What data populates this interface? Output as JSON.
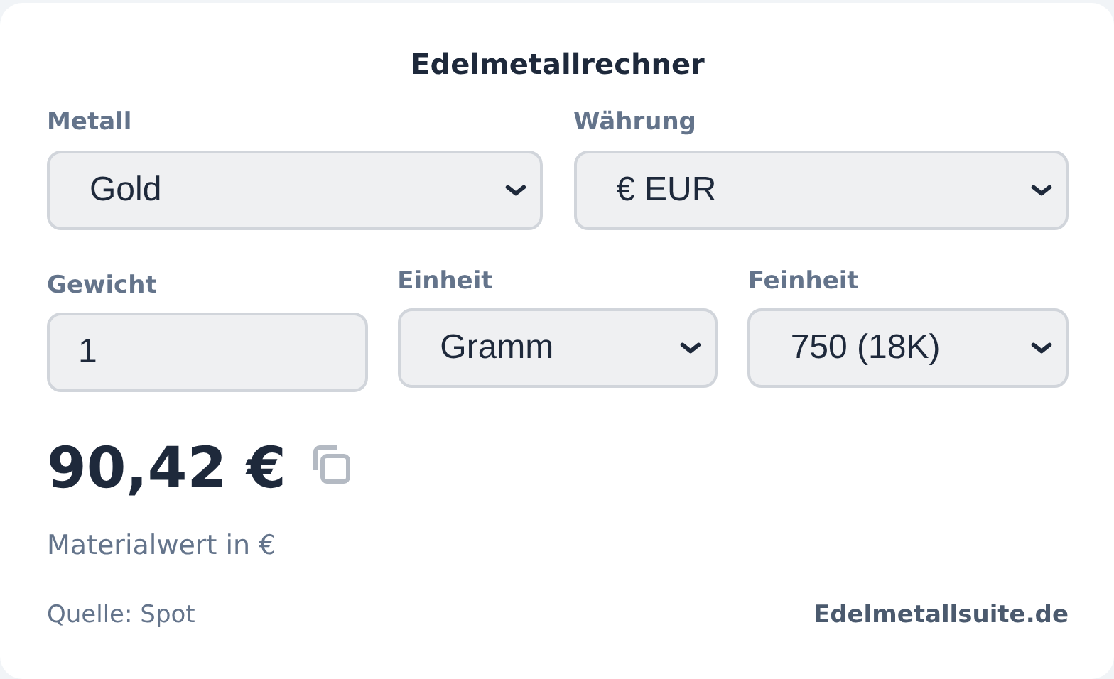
{
  "title": "Edelmetallrechner",
  "fields": [
    {
      "kind": "select",
      "label": "Metall",
      "value": "Gold"
    },
    {
      "kind": "select",
      "label": "Währung",
      "value": "€ EUR"
    },
    {
      "kind": "input",
      "label": "Gewicht",
      "value": "1"
    },
    {
      "kind": "select",
      "label": "Einheit",
      "value": "Gramm"
    },
    {
      "kind": "select",
      "label": "Feinheit",
      "value": "750 (18K)"
    }
  ],
  "result": {
    "value": "90,42 €",
    "caption": "Materialwert in €"
  },
  "footer": {
    "source": "Quelle: Spot",
    "link": "Edelmetallsuite.de"
  }
}
